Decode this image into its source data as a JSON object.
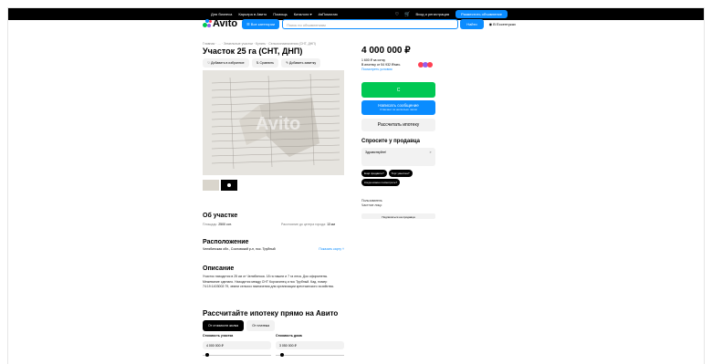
{
  "topbar": {
    "links": [
      "Для бизнеса",
      "Карьера в Авито",
      "Помощь",
      "Каталоги ▾",
      "#яПомогаю"
    ],
    "login": "Вход и регистрация",
    "post_ad": "Разместить объявление"
  },
  "header": {
    "logo": "Avito",
    "all_categories": "☰ Все категории",
    "search_placeholder": "Поиск по объявлениям",
    "find": "Найти",
    "region": "В Ессентуках"
  },
  "listing": {
    "breadcrumb": "Главная · … · Земельные участки · Купить · Сельхозназначения (СНТ, ДНП)",
    "title": "Участок 25 га (СНТ, ДНП)",
    "actions": [
      "♡ Добавить в избранное",
      "⇅ Сравнить",
      "✎ Добавить заметку"
    ],
    "photo_watermark": "Avito",
    "about_title": "Об участке",
    "area_label": "Площадь:",
    "area_value": "2500 сот.",
    "distance_label": "Расстояние до центра города:",
    "distance_value": "13 км",
    "location_title": "Расположение",
    "address": "Челябинская обл., Сосновский р-н, пос. Трубный",
    "show_map": "Показать карту ˅",
    "description_title": "Описание",
    "description": "Участок находится в 25 км от Челябинска. 18 га пашни и 7 га леса. Док оформлены. Межевание сделано. Находится между СНТ Корчагинец и пос Трубный. Кад. номер 74:19:1403002:79, земли сельхоз назначения для организации крестьянского хозяйства.",
    "mortgage_title": "Рассчитайте ипотеку прямо на Авито",
    "mortgage_tabs": [
      "От стоимости жилья",
      "От платежа"
    ],
    "plot_cost_label": "Стоимость участка",
    "house_cost_label": "Стоимость дома",
    "plot_cost_value": "4 000 000 ₽",
    "house_cost_value": "3 050 000 ₽",
    "plot_slider_fraction": 0.04,
    "house_slider_fraction": 0.06
  },
  "sidebar": {
    "price": "4 000 000 ₽",
    "price_per": "1 600 ₽ за сотку",
    "mortgage_line": "В ипотеку от 54 932 ₽/мес.",
    "mortgage_link": "Посмотреть условия",
    "phone_button": "С",
    "message_button": "Написать сообщение",
    "message_sub": "Отвечает за несколько часов",
    "calc_mortgage": "Рассчитать ипотеку",
    "ask_title": "Спросите у продавца",
    "ask_placeholder": "Здравствуйте!",
    "ask_send": "➤",
    "chips": [
      "Ещё продаёте?",
      "Торг уместен?",
      "Когда можно посмотреть?"
    ],
    "seller_type": "Пользователь",
    "seller_kind": "Частное лицо",
    "subscribe": "Подписаться на продавца"
  },
  "colors": {
    "accent": "#0a8cff",
    "green": "#00c853",
    "badge_colors": [
      "#ff4053",
      "#965eeb",
      "#ff4053"
    ]
  }
}
